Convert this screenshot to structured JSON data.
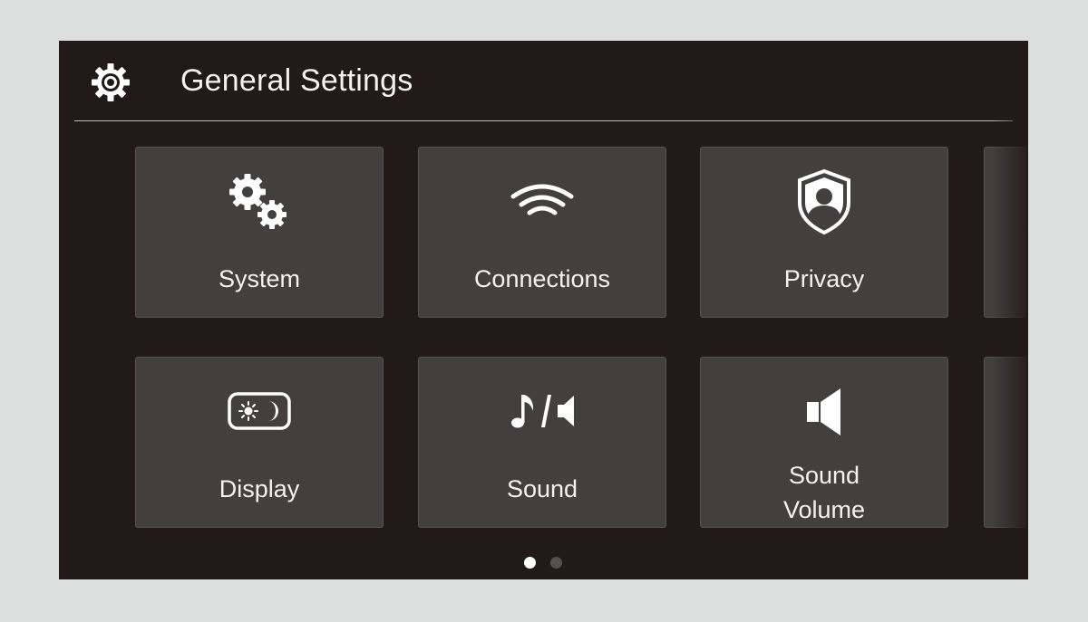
{
  "header": {
    "title": "General Settings",
    "icon": "gear-icon"
  },
  "tiles": [
    {
      "label": "System",
      "icon": "gears-icon"
    },
    {
      "label": "Connections",
      "icon": "wifi-icon"
    },
    {
      "label": "Privacy",
      "icon": "privacy-shield-icon"
    },
    {
      "label": "Display",
      "icon": "display-day-night-icon"
    },
    {
      "label": "Sound",
      "icon": "music-speaker-icon"
    },
    {
      "label_line1": "Sound",
      "label_line2": "Volume",
      "icon": "speaker-icon"
    }
  ],
  "pagination": {
    "pages": 2,
    "current": 1
  },
  "colors": {
    "background": "#221a18",
    "tile": "#423f3e",
    "text": "#f3f3f3",
    "dot_active": "#ffffff",
    "dot_inactive": "#55504e"
  }
}
